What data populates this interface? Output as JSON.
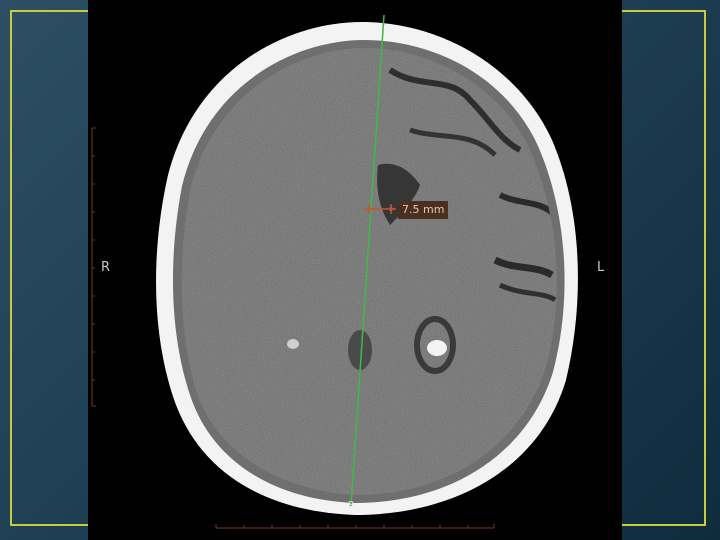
{
  "image": {
    "left_label": "R",
    "right_label": "L",
    "measurement": "7.5 mm",
    "bottom_marker": "P"
  },
  "colors": {
    "frame": "#c8cc3a",
    "midline": "#3fb948",
    "measure_marker": "#c2553b",
    "ruler": "#7a2f2a"
  }
}
